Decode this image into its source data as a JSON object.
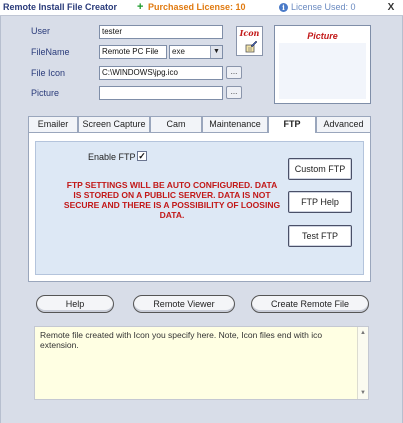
{
  "titlebar": {
    "title": "Remote Install File Creator",
    "license_icon": "+",
    "license_text": "Purchased License: 10",
    "info_icon": "i",
    "used_text": "License Used: 0",
    "close_label": "X"
  },
  "form": {
    "user_label": "User",
    "user_value": "tester",
    "filename_label": "FileName",
    "filename_value": "Remote PC File",
    "extension_value": "exe",
    "fileicon_label": "File Icon",
    "fileicon_value": "C:\\WINDOWS\\jpg.ico",
    "picture_label": "Picture",
    "picture_value": "",
    "browse_label": "...",
    "icon_title": "Icon",
    "picture_title": "Picture"
  },
  "tabs": [
    {
      "label": "Emailer"
    },
    {
      "label": "Screen Capture"
    },
    {
      "label": "Cam"
    },
    {
      "label": "Maintenance"
    },
    {
      "label": "FTP"
    },
    {
      "label": "Advanced"
    }
  ],
  "active_tab": "FTP",
  "ftp": {
    "enable_label": "Enable FTP",
    "enabled": true,
    "check_mark": "✓",
    "warning": "FTP SETTINGS WILL BE AUTO CONFIGURED. DATA IS STORED ON A PUBLIC SERVER. DATA IS NOT SECURE AND THERE IS A POSSIBILITY OF LOOSING DATA.",
    "custom_ftp_label": "Custom FTP",
    "ftp_help_label": "FTP Help",
    "test_ftp_label": "Test FTP"
  },
  "bottom_buttons": {
    "help_label": "Help",
    "remote_viewer_label": "Remote Viewer",
    "create_label": "Create Remote File"
  },
  "note": {
    "text": "Remote file created with Icon you specify here. Note, Icon files end with ico extension.",
    "scroll_up": "▲",
    "scroll_down": "▼"
  },
  "colors": {
    "title": "#2a3b7a",
    "license": "#e07a10",
    "warning": "#c21818",
    "panel": "#dde8f5",
    "note_bg": "#ffffe3"
  }
}
